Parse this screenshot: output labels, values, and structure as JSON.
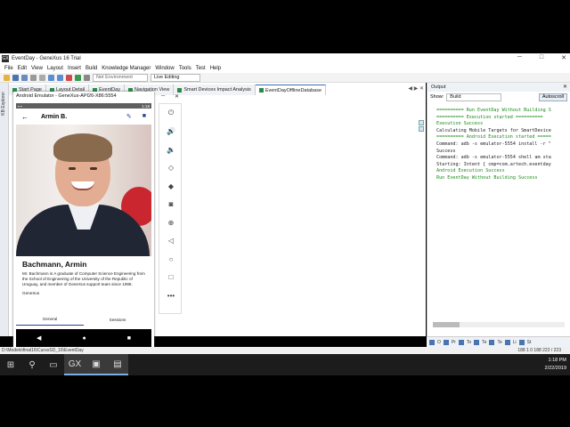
{
  "window": {
    "title": "EventDay - GeneXus 16 Trial",
    "app_icon": "GX"
  },
  "menu": [
    "File",
    "Edit",
    "View",
    "Layout",
    "Insert",
    "Build",
    "Knowledge Manager",
    "Window",
    "Tools",
    "Test",
    "Help"
  ],
  "toolbar": {
    "environment": "Net Environment",
    "mode": "Live Editing"
  },
  "left_strip": "KB Explorer",
  "tabs": [
    {
      "label": "Start Page"
    },
    {
      "label": "Layout Detail"
    },
    {
      "label": "EventDay"
    },
    {
      "label": "Navigation View"
    },
    {
      "label": "Smart Devices Impact Analysis"
    },
    {
      "label": "EventDayOfflineDatabase"
    }
  ],
  "emulator": {
    "title": "Android Emulator - GeneXus-API26-X86:5554",
    "time": "1:18",
    "screen_title": "Armin B.",
    "full_name": "Bachmann, Armin",
    "bio": "Mr. Bachmann is A graduate of Computer Science Engineering from the School of Engineering of the University of the Republic of Uruguay, and member of GeneXus support team since 1998.",
    "company": "GeneXus",
    "tabs": [
      "General",
      "Sessions"
    ]
  },
  "output": {
    "title": "Output",
    "show_label": "Show:",
    "show_value": "Build",
    "autoscroll": "Autoscroll",
    "lines": [
      {
        "text": "========== Run EventDay Without Building S",
        "color": "#1a8a1a"
      },
      {
        "text": "========== Execution started ==========",
        "color": "#1a8a1a"
      },
      {
        "text": "Execution Success",
        "color": "#1a8a1a"
      },
      {
        "text": "Calculating Mobile Targets for SmartDevice",
        "color": "#222222"
      },
      {
        "text": "========== Android Execution started =====",
        "color": "#1a8a1a"
      },
      {
        "text": "Command: adb -s emulator-5554 install -r \"",
        "color": "#222222"
      },
      {
        "text": "Success",
        "color": "#222222"
      },
      {
        "text": "Command: adb -s emulator-5554 shell am sta",
        "color": "#222222"
      },
      {
        "text": "Starting: Intent { cmp=com.artech.eventday",
        "color": "#222222"
      },
      {
        "text": "Android Execution Success",
        "color": "#1a8a1a"
      },
      {
        "text": "Run EventDay Without Building Success",
        "color": "#1a8a1a"
      }
    ]
  },
  "bottom_tabs": [
    "O",
    "Pr",
    "To",
    "Te",
    "Te",
    "Li",
    "St"
  ],
  "status": {
    "path": "D:\\Models\\final16\\CursoSD_16\\EventDay",
    "position": "188  1  0  188  222 / 223"
  },
  "clock": {
    "time": "1:18 PM",
    "date": "2/22/2019"
  }
}
